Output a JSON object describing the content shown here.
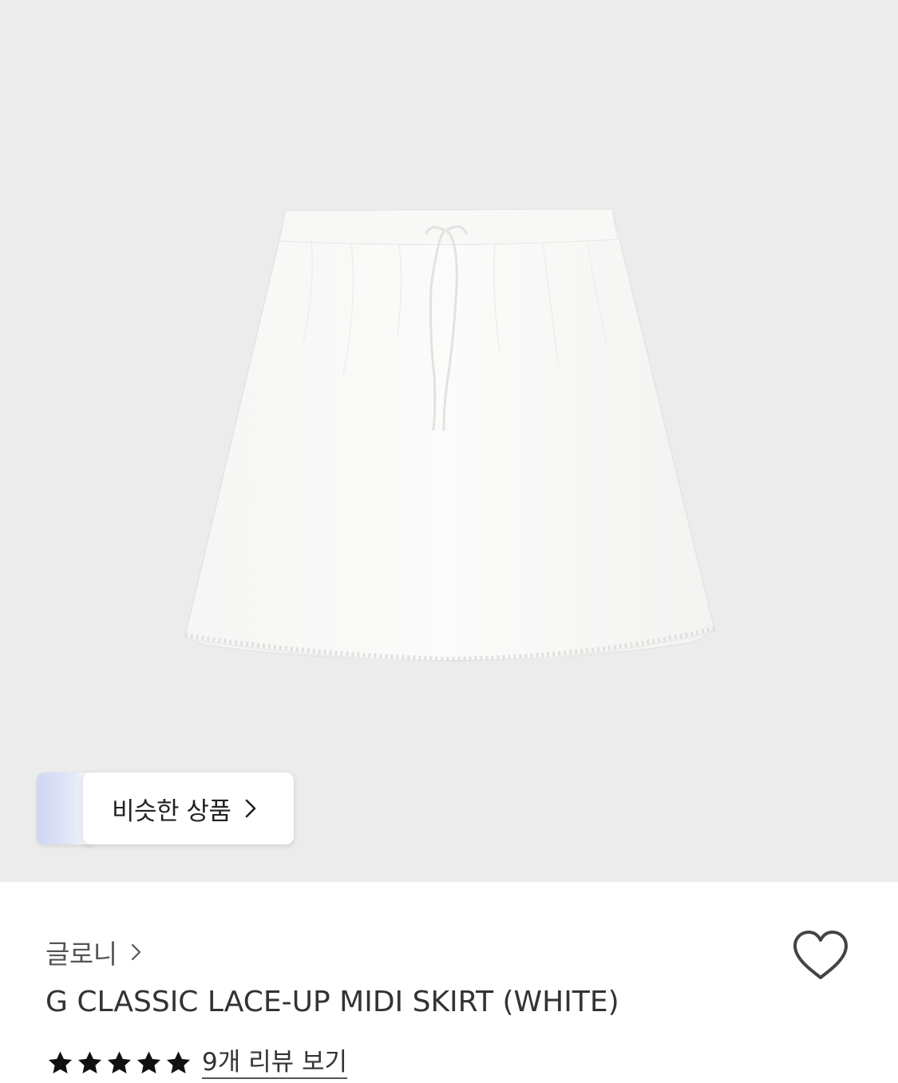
{
  "image": {
    "background_color": "#ececec",
    "subject": "skirt-image"
  },
  "similar": {
    "label": "비슷한 상품",
    "chevron_icon": "chevron-right-icon"
  },
  "brand": {
    "name": "글로니",
    "chevron_icon": "chevron-right-icon"
  },
  "wishlist": {
    "icon": "heart-outline-icon"
  },
  "product": {
    "title": "G CLASSIC LACE-UP MIDI SKIRT (WHITE)"
  },
  "rating": {
    "stars": 5,
    "max": 5,
    "review_link": "9개 리뷰 보기"
  },
  "colors": {
    "image_bg": "#ececec",
    "page_bg": "#ffffff",
    "text_primary": "#333333",
    "text_brand": "#555555",
    "star": "#111111",
    "heart_stroke": "#444444"
  }
}
